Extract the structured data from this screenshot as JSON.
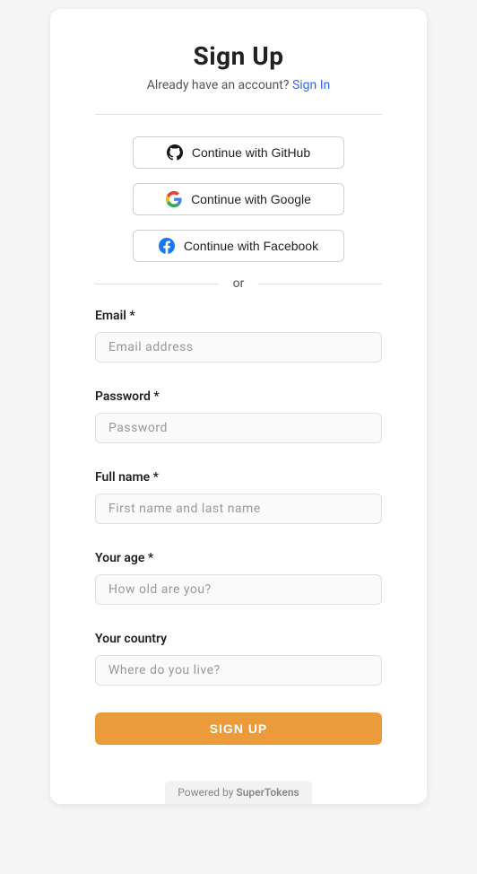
{
  "header": {
    "title": "Sign Up",
    "subtitle_prefix": "Already have an account? ",
    "signin_link": "Sign In"
  },
  "social": {
    "github_label": "Continue with GitHub",
    "google_label": "Continue with Google",
    "facebook_label": "Continue with Facebook"
  },
  "divider": {
    "or_text": "or"
  },
  "form": {
    "email": {
      "label": "Email *",
      "placeholder": "Email address",
      "value": ""
    },
    "password": {
      "label": "Password *",
      "placeholder": "Password",
      "value": ""
    },
    "fullname": {
      "label": "Full name *",
      "placeholder": "First name and last name",
      "value": ""
    },
    "age": {
      "label": "Your age *",
      "placeholder": "How old are you?",
      "value": ""
    },
    "country": {
      "label": "Your country",
      "placeholder": "Where do you live?",
      "value": ""
    },
    "submit_label": "SIGN UP"
  },
  "footer": {
    "prefix": "Powered by ",
    "brand": "SuperTokens"
  }
}
